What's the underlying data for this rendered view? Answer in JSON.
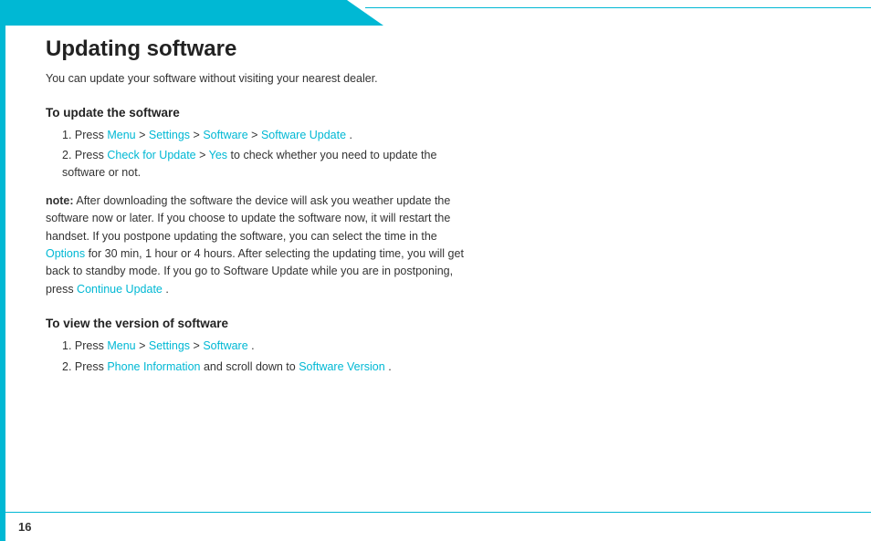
{
  "header": {
    "title": "Updating software"
  },
  "intro": "You can update your software without visiting your nearest dealer.",
  "section1": {
    "heading": "To update the software",
    "steps": [
      {
        "number": "1.",
        "prefix": "Press ",
        "links": [
          {
            "text": "Menu",
            "sep": " > "
          },
          {
            "text": "Settings",
            "sep": " > "
          },
          {
            "text": "Software",
            "sep": " > "
          },
          {
            "text": "Software Update",
            "sep": "."
          }
        ]
      },
      {
        "number": "2.",
        "prefix": "Press ",
        "links": [
          {
            "text": "Check for Update",
            "sep": " > "
          },
          {
            "text": "Yes",
            "sep": ""
          }
        ],
        "suffix": " to check whether you need to update the software or not."
      }
    ]
  },
  "note": {
    "bold": "note:",
    "text": " After downloading the software the device will ask you weather update the software now or later. If you choose to update the software now, it will restart the handset. If you postpone updating the software, you can select the time in the ",
    "options_link": "Options",
    "text2": " for 30 min, 1 hour or 4 hours. After selecting the updating time, you will get back to standby mode. If you go to Software Update while you are in postponing, press ",
    "continue_link": "Continue Update",
    "text3": "."
  },
  "section2": {
    "heading": "To view the version of software",
    "steps": [
      {
        "number": "1.",
        "prefix": "Press ",
        "links": [
          {
            "text": "Menu",
            "sep": " > "
          },
          {
            "text": "Settings",
            "sep": " > "
          },
          {
            "text": "Software",
            "sep": "."
          }
        ]
      },
      {
        "number": "2.",
        "prefix": "Press ",
        "links": [
          {
            "text": "Phone Information",
            "sep": ""
          }
        ],
        "suffix": " and scroll down to ",
        "links2": [
          {
            "text": "Software Version",
            "sep": ""
          }
        ],
        "suffix2": "."
      }
    ]
  },
  "footer": {
    "page_number": "16"
  },
  "colors": {
    "accent": "#00b8d4",
    "text": "#333333",
    "heading": "#222222"
  }
}
